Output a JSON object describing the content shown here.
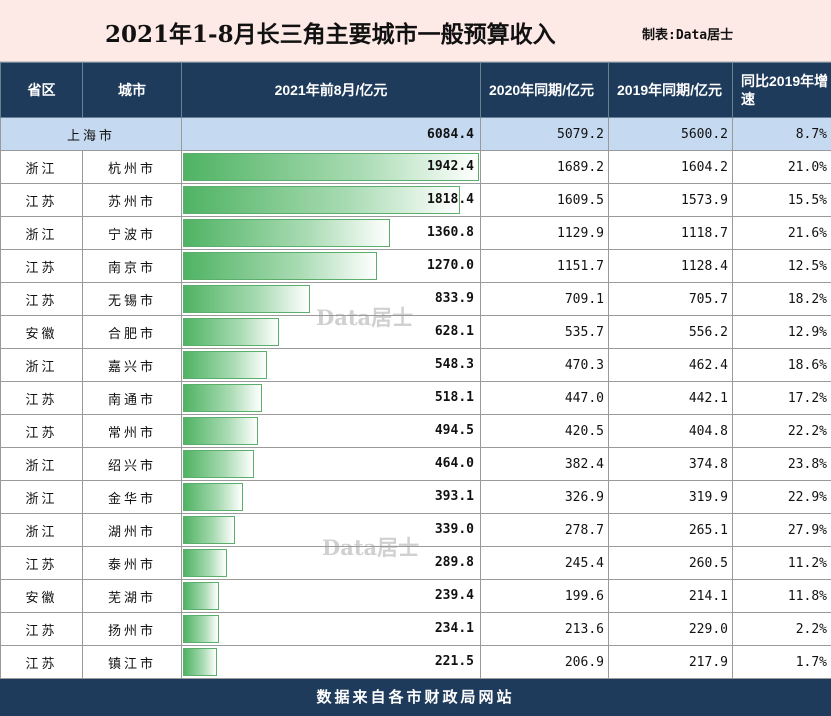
{
  "header": {
    "title": "2021年1-8月长三角主要城市一般预算收入",
    "maker": "制表:Data居士"
  },
  "columns": {
    "province": "省区",
    "city": "城市",
    "current": "2021年前8月/亿元",
    "y2020": "2020年同期/亿元",
    "y2019": "2019年同期/亿元",
    "growth": "同比2019年增速"
  },
  "shanghai": {
    "name": "上海市",
    "current": "6084.4",
    "y2020": "5079.2",
    "y2019": "5600.2",
    "growth": "8.7%"
  },
  "chart_data": {
    "type": "bar",
    "categories": [
      "杭州市",
      "苏州市",
      "宁波市",
      "南京市",
      "无锡市",
      "合肥市",
      "嘉兴市",
      "南通市",
      "常州市",
      "绍兴市",
      "金华市",
      "湖州市",
      "泰州市",
      "芜湖市",
      "扬州市",
      "镇江市"
    ],
    "values": [
      1942.4,
      1818.4,
      1360.8,
      1270.0,
      833.9,
      628.1,
      548.3,
      518.1,
      494.5,
      464.0,
      393.1,
      339.0,
      289.8,
      239.4,
      234.1,
      221.5
    ],
    "xlim": [
      0,
      1942.4
    ]
  },
  "rows": [
    {
      "province": "浙江",
      "city": "杭州市",
      "current": "1942.4",
      "y2020": "1689.2",
      "y2019": "1604.2",
      "growth": "21.0%"
    },
    {
      "province": "江苏",
      "city": "苏州市",
      "current": "1818.4",
      "y2020": "1609.5",
      "y2019": "1573.9",
      "growth": "15.5%"
    },
    {
      "province": "浙江",
      "city": "宁波市",
      "current": "1360.8",
      "y2020": "1129.9",
      "y2019": "1118.7",
      "growth": "21.6%"
    },
    {
      "province": "江苏",
      "city": "南京市",
      "current": "1270.0",
      "y2020": "1151.7",
      "y2019": "1128.4",
      "growth": "12.5%"
    },
    {
      "province": "江苏",
      "city": "无锡市",
      "current": "833.9",
      "y2020": "709.1",
      "y2019": "705.7",
      "growth": "18.2%"
    },
    {
      "province": "安徽",
      "city": "合肥市",
      "current": "628.1",
      "y2020": "535.7",
      "y2019": "556.2",
      "growth": "12.9%"
    },
    {
      "province": "浙江",
      "city": "嘉兴市",
      "current": "548.3",
      "y2020": "470.3",
      "y2019": "462.4",
      "growth": "18.6%"
    },
    {
      "province": "江苏",
      "city": "南通市",
      "current": "518.1",
      "y2020": "447.0",
      "y2019": "442.1",
      "growth": "17.2%"
    },
    {
      "province": "江苏",
      "city": "常州市",
      "current": "494.5",
      "y2020": "420.5",
      "y2019": "404.8",
      "growth": "22.2%"
    },
    {
      "province": "浙江",
      "city": "绍兴市",
      "current": "464.0",
      "y2020": "382.4",
      "y2019": "374.8",
      "growth": "23.8%"
    },
    {
      "province": "浙江",
      "city": "金华市",
      "current": "393.1",
      "y2020": "326.9",
      "y2019": "319.9",
      "growth": "22.9%"
    },
    {
      "province": "浙江",
      "city": "湖州市",
      "current": "339.0",
      "y2020": "278.7",
      "y2019": "265.1",
      "growth": "27.9%"
    },
    {
      "province": "江苏",
      "city": "泰州市",
      "current": "289.8",
      "y2020": "245.4",
      "y2019": "260.5",
      "growth": "11.2%"
    },
    {
      "province": "安徽",
      "city": "芜湖市",
      "current": "239.4",
      "y2020": "199.6",
      "y2019": "214.1",
      "growth": "11.8%"
    },
    {
      "province": "江苏",
      "city": "扬州市",
      "current": "234.1",
      "y2020": "213.6",
      "y2019": "229.0",
      "growth": "2.2%"
    },
    {
      "province": "江苏",
      "city": "镇江市",
      "current": "221.5",
      "y2020": "206.9",
      "y2019": "217.9",
      "growth": "1.7%"
    }
  ],
  "footer": "数据来自各市财政局网站",
  "watermark": "Data居士"
}
